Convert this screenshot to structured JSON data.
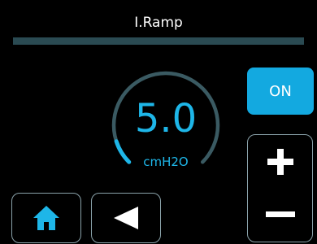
{
  "header": {
    "title": "I.Ramp"
  },
  "dial": {
    "value": "5.0",
    "unit": "cmH2O",
    "level": 0.1,
    "accent_color": "#1eb6e8",
    "track_color": "#3a5a62"
  },
  "controls": {
    "on_label": "ON",
    "increase_icon": "plus-icon",
    "decrease_icon": "minus-icon"
  },
  "nav": {
    "home_icon": "home-icon",
    "back_icon": "back-arrow-icon"
  }
}
